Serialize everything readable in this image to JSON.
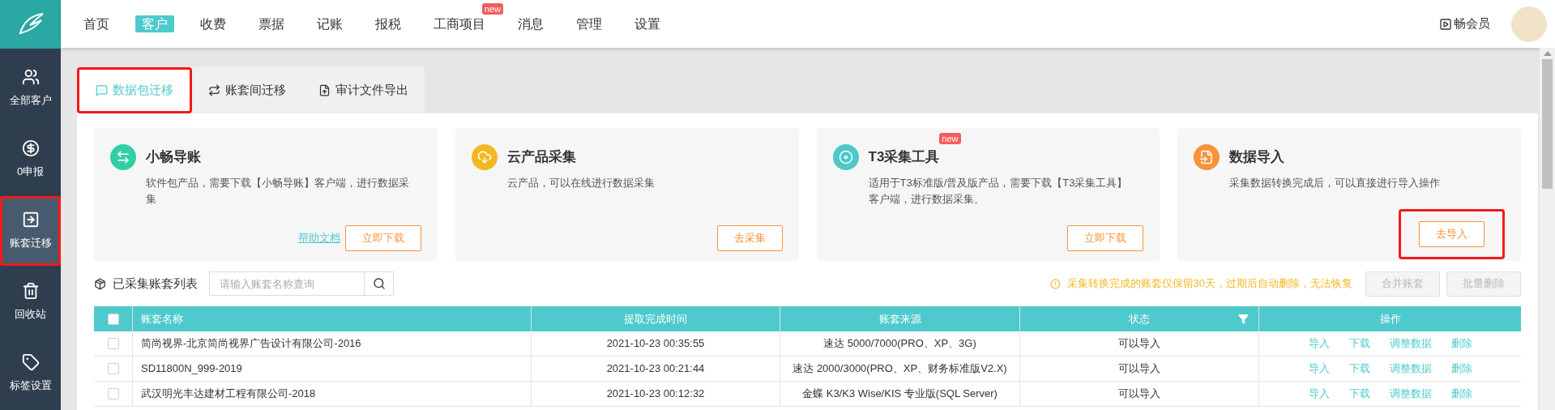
{
  "top_nav": {
    "items": [
      {
        "label": "首页",
        "selected": false
      },
      {
        "label": "客户",
        "selected": true
      },
      {
        "label": "收费",
        "selected": false
      },
      {
        "label": "票据",
        "selected": false
      },
      {
        "label": "记账",
        "selected": false
      },
      {
        "label": "报税",
        "selected": false
      },
      {
        "label": "工商项目",
        "selected": false,
        "badge": "new"
      },
      {
        "label": "消息",
        "selected": false
      },
      {
        "label": "管理",
        "selected": false
      },
      {
        "label": "设置",
        "selected": false
      }
    ],
    "member": "畅会员"
  },
  "sidebar": {
    "items": [
      {
        "label": "全部客户",
        "selected": false,
        "highlighted": false
      },
      {
        "label": "0申报",
        "selected": false,
        "highlighted": false
      },
      {
        "label": "账套迁移",
        "selected": true,
        "highlighted": true
      },
      {
        "label": "回收站",
        "selected": false,
        "highlighted": false
      },
      {
        "label": "标签设置",
        "selected": false,
        "highlighted": false
      }
    ]
  },
  "tabs": [
    {
      "label": "数据包迁移",
      "selected": true,
      "highlighted": true
    },
    {
      "label": "账套间迁移",
      "selected": false,
      "highlighted": false
    },
    {
      "label": "审计文件导出",
      "selected": false,
      "highlighted": false
    }
  ],
  "cards": [
    {
      "title": "小畅导账",
      "description": "软件包产品，需要下载【小畅导账】客户端，进行数据采集",
      "link": "帮助文档",
      "button": "立即下载",
      "highlighted": false
    },
    {
      "title": "云产品采集",
      "description": "云产品，可以在线进行数据采集",
      "button": "去采集",
      "highlighted": false
    },
    {
      "title": "T3采集工具",
      "badge": "new",
      "description": "适用于T3标准版/普及版产品，需要下载【T3采集工具】客户端，进行数据采集。",
      "button": "立即下载",
      "highlighted": false
    },
    {
      "title": "数据导入",
      "description": "采集数据转换完成后，可以直接进行导入操作",
      "button": "去导入",
      "highlighted": true
    }
  ],
  "list_title": "已采集账套列表",
  "search": {
    "placeholder": "请输入账套名称查询"
  },
  "notice": "采集转换完成的账套仅保留30天，过期后自动删除，无法恢复",
  "actions": [
    {
      "label": "合并账套",
      "disabled": true
    },
    {
      "label": "批量删除",
      "disabled": true
    }
  ],
  "table": {
    "header_checked": false,
    "columns": [
      "账套名称",
      "提取完成时间",
      "账套来源",
      "状态",
      "操作"
    ],
    "rows": [
      {
        "checked": false,
        "cells": [
          "简尚视界-北京简尚视界广告设计有限公司-2016",
          "2021-10-23 00:35:55",
          "速达 5000/7000(PRO、XP、3G)",
          "可以导入"
        ],
        "actions": [
          "导入",
          "下载",
          "调整数据",
          "删除"
        ]
      },
      {
        "checked": false,
        "cells": [
          "SD11800N_999-2019",
          "2021-10-23 00:21:44",
          "速达 2000/3000(PRO、XP、财务标准版V2.X)",
          "可以导入"
        ],
        "actions": [
          "导入",
          "下载",
          "调整数据",
          "删除"
        ]
      },
      {
        "checked": false,
        "cells": [
          "武汉明光丰达建材工程有限公司-2018",
          "2021-10-23 00:12:32",
          "金蝶 K3/K3 Wise/KIS 专业版(SQL Server)",
          "可以导入"
        ],
        "actions": [
          "导入",
          "下载",
          "调整数据",
          "删除"
        ]
      }
    ]
  }
}
